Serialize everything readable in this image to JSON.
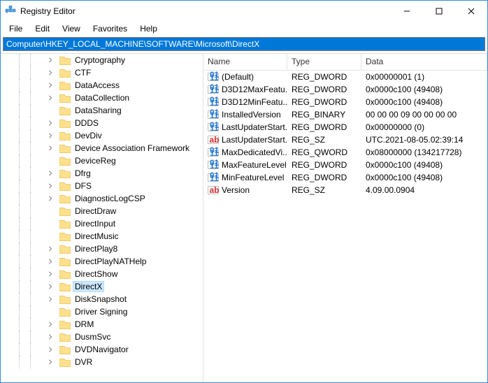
{
  "window": {
    "title": "Registry Editor"
  },
  "menu": {
    "file": "File",
    "edit": "Edit",
    "view": "View",
    "favorites": "Favorites",
    "help": "Help"
  },
  "address": "Computer\\HKEY_LOCAL_MACHINE\\SOFTWARE\\Microsoft\\DirectX",
  "tree": [
    {
      "label": "Cryptography",
      "expandable": true
    },
    {
      "label": "CTF",
      "expandable": true
    },
    {
      "label": "DataAccess",
      "expandable": true
    },
    {
      "label": "DataCollection",
      "expandable": true
    },
    {
      "label": "DataSharing",
      "expandable": false
    },
    {
      "label": "DDDS",
      "expandable": true
    },
    {
      "label": "DevDiv",
      "expandable": true
    },
    {
      "label": "Device Association Framework",
      "expandable": true
    },
    {
      "label": "DeviceReg",
      "expandable": false
    },
    {
      "label": "Dfrg",
      "expandable": true
    },
    {
      "label": "DFS",
      "expandable": true
    },
    {
      "label": "DiagnosticLogCSP",
      "expandable": true
    },
    {
      "label": "DirectDraw",
      "expandable": false
    },
    {
      "label": "DirectInput",
      "expandable": false
    },
    {
      "label": "DirectMusic",
      "expandable": false
    },
    {
      "label": "DirectPlay8",
      "expandable": true
    },
    {
      "label": "DirectPlayNATHelp",
      "expandable": true
    },
    {
      "label": "DirectShow",
      "expandable": true
    },
    {
      "label": "DirectX",
      "expandable": true,
      "selected": true
    },
    {
      "label": "DiskSnapshot",
      "expandable": true
    },
    {
      "label": "Driver Signing",
      "expandable": false
    },
    {
      "label": "DRM",
      "expandable": true
    },
    {
      "label": "DusmSvc",
      "expandable": true
    },
    {
      "label": "DVDNavigator",
      "expandable": true
    },
    {
      "label": "DVR",
      "expandable": true
    }
  ],
  "columns": {
    "name": "Name",
    "type": "Type",
    "data": "Data"
  },
  "values": [
    {
      "name": "(Default)",
      "type": "REG_DWORD",
      "data": "0x00000001 (1)",
      "icon": "bin"
    },
    {
      "name": "D3D12MaxFeatu...",
      "type": "REG_DWORD",
      "data": "0x0000c100 (49408)",
      "icon": "bin"
    },
    {
      "name": "D3D12MinFeatu...",
      "type": "REG_DWORD",
      "data": "0x0000c100 (49408)",
      "icon": "bin"
    },
    {
      "name": "InstalledVersion",
      "type": "REG_BINARY",
      "data": "00 00 00 09 00 00 00 00",
      "icon": "bin"
    },
    {
      "name": "LastUpdaterStart...",
      "type": "REG_DWORD",
      "data": "0x00000000 (0)",
      "icon": "bin"
    },
    {
      "name": "LastUpdaterStart...",
      "type": "REG_SZ",
      "data": "UTC.2021-08-05.02:39:14",
      "icon": "str"
    },
    {
      "name": "MaxDedicatedVi...",
      "type": "REG_QWORD",
      "data": "0x08000000 (134217728)",
      "icon": "bin"
    },
    {
      "name": "MaxFeatureLevel",
      "type": "REG_DWORD",
      "data": "0x0000c100 (49408)",
      "icon": "bin"
    },
    {
      "name": "MinFeatureLevel",
      "type": "REG_DWORD",
      "data": "0x0000c100 (49408)",
      "icon": "bin"
    },
    {
      "name": "Version",
      "type": "REG_SZ",
      "data": "4.09.00.0904",
      "icon": "str"
    }
  ]
}
